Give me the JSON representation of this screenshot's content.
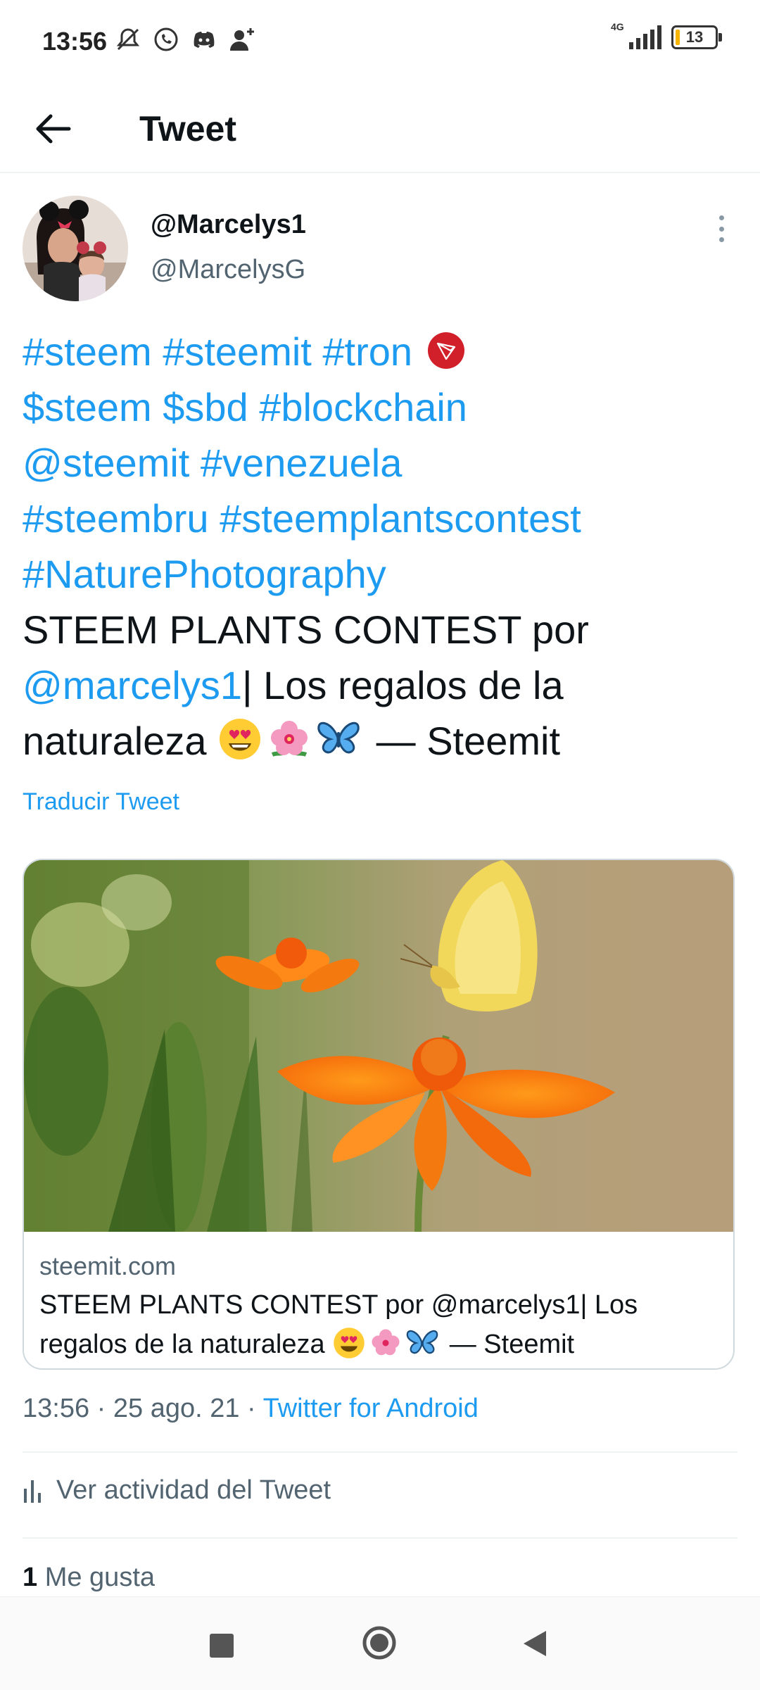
{
  "status_bar": {
    "time": "13:56",
    "network": "4G",
    "battery": "13",
    "icons": [
      "mute-icon",
      "whatsapp-icon",
      "discord-icon",
      "add-person-icon"
    ]
  },
  "header": {
    "title": "Tweet",
    "back_icon": "arrow-left-icon"
  },
  "author": {
    "display_name": "@Marcelys1",
    "handle": "@MarcelysG"
  },
  "tweet": {
    "hashtags_line1": [
      "#steem",
      "#steemit",
      "#tron"
    ],
    "cashtags_line2": [
      "$steem",
      "$sbd",
      "#blockchain"
    ],
    "mention_line3": "@steemit",
    "hashtag_venezuela": "#venezuela",
    "hashtags_line4": [
      "#steembru",
      "#steemplantscontest"
    ],
    "hashtag_line5": "#NaturePhotography",
    "text_part1": "STEEM PLANTS CONTEST por",
    "mention_author": "@marcelys1",
    "text_part2": "| Los regalos de la",
    "text_part3": "naturaleza",
    "text_part4": "— Steemit",
    "emojis": [
      "heart-eyes-emoji",
      "hibiscus-emoji",
      "butterfly-emoji"
    ],
    "translate_label": "Traducir Tweet"
  },
  "card": {
    "domain": "steemit.com",
    "title_part1": "STEEM PLANTS CONTEST por @marcelys1| Los regalos de la naturaleza",
    "title_part2": "— Steemit"
  },
  "meta": {
    "time": "13:56",
    "sep": "·",
    "date": "25 ago. 21",
    "source": "Twitter for Android"
  },
  "activity": {
    "label": "Ver actividad del Tweet"
  },
  "likes": {
    "count": "1",
    "label": "Me gusta"
  },
  "colors": {
    "link": "#1d9bf0",
    "text": "#0f1419",
    "secondary": "#536471",
    "border": "#cfd9de"
  }
}
